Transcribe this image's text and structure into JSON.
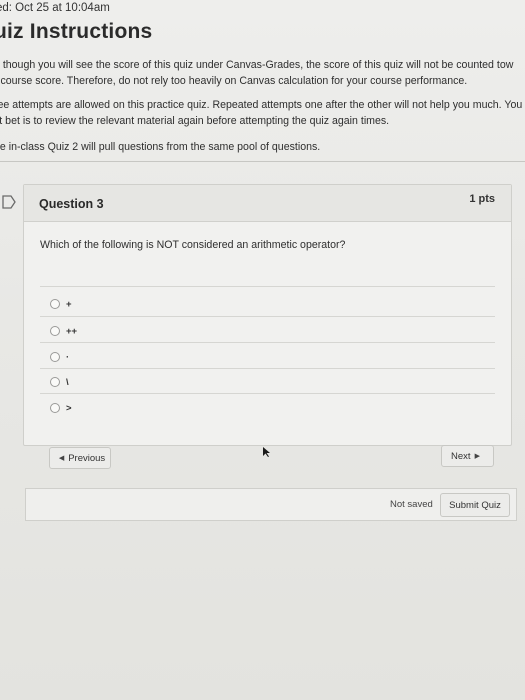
{
  "header": {
    "started": "ed: Oct 25 at 10:04am",
    "title": "uiz Instructions"
  },
  "instructions": {
    "p1_line1": "n though you will see the score of this quiz under Canvas-Grades, the score of this quiz will not be counted tow",
    "p1_line2": "r course score.  Therefore, do not rely too heavily on Canvas calculation for your course performance.",
    "p2_line1": "ree attempts are allowed on this practice quiz. Repeated attempts one after the other will not help you much. You",
    "p2_line2": "st bet is to review the relevant material again before attempting the quiz again times.",
    "p3_line1": "ne in-class Quiz 2 will pull questions from the same pool of questions."
  },
  "question": {
    "name": "Question 3",
    "points": "1 pts",
    "text": "Which of the following is NOT considered an arithmetic operator?",
    "answers": [
      {
        "label": "+"
      },
      {
        "label": "++"
      },
      {
        "label": "·"
      },
      {
        "label": "\\"
      },
      {
        "label": ">"
      }
    ]
  },
  "navigation": {
    "previous_label": "Previous",
    "next_label": "Next",
    "previous_icon": "triangle-left-icon",
    "next_icon": "triangle-right-icon"
  },
  "footer": {
    "status": "Not saved",
    "submit_label": "Submit Quiz"
  }
}
